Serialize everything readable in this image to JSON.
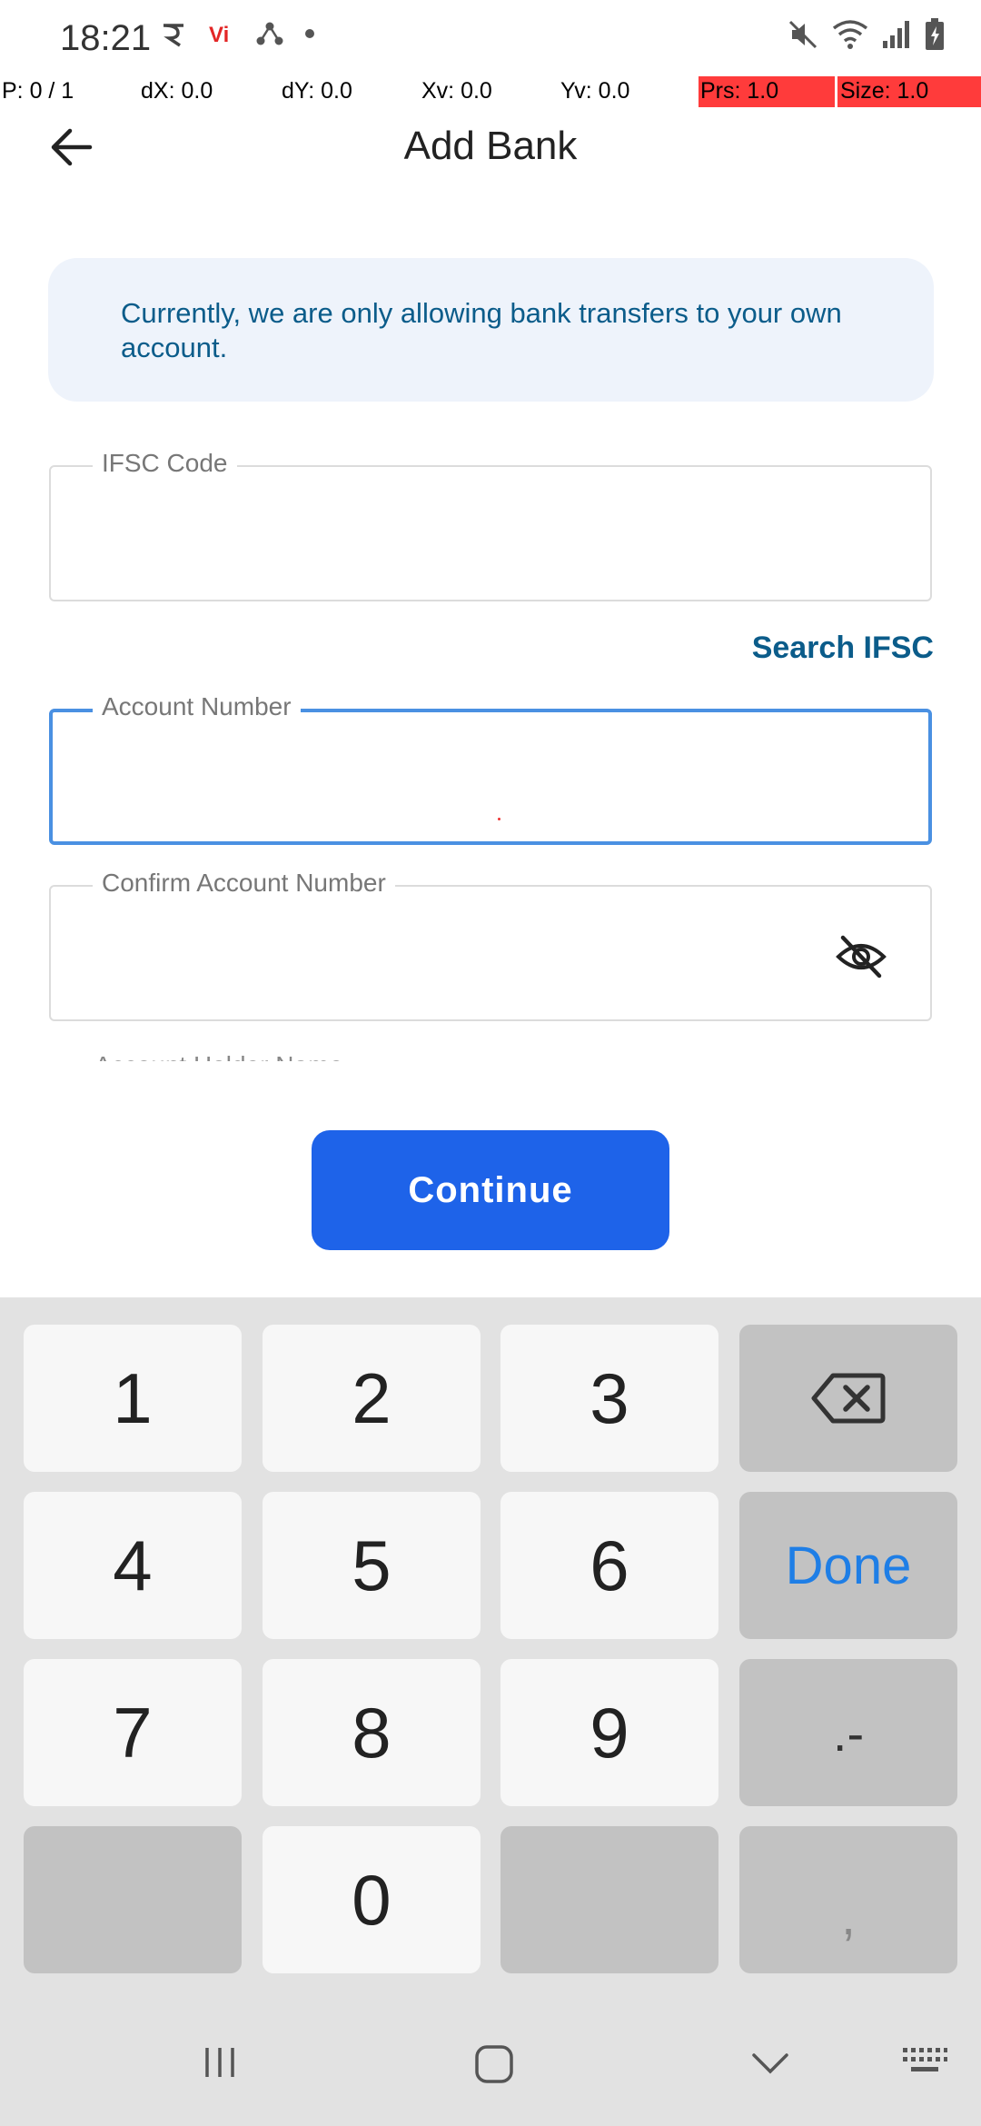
{
  "status_bar": {
    "time": "18:21",
    "left_icons": [
      "jio-icon",
      "vi-icon",
      "share-icon",
      "dot-icon"
    ],
    "right_icons": [
      "mute-icon",
      "wifi-icon",
      "signal-icon",
      "battery-icon"
    ]
  },
  "debug": {
    "p": "P: 0 / 1",
    "dx": "dX: 0.0",
    "dy": "dY: 0.0",
    "xv": "Xv: 0.0",
    "yv": "Yv: 0.0",
    "prs": "Prs: 1.0",
    "size": "Size: 1.0"
  },
  "app_bar": {
    "title": "Add Bank",
    "back_icon": "arrow-left-icon"
  },
  "info_banner": {
    "text": "Currently, we are only allowing bank transfers to your own account."
  },
  "form": {
    "ifsc": {
      "label": "IFSC Code",
      "value": ""
    },
    "search_ifsc": "Search IFSC",
    "account_number": {
      "label": "Account Number",
      "value": ""
    },
    "confirm_account_number": {
      "label": "Confirm Account Number",
      "value": "",
      "icon": "eye-off-icon"
    },
    "next_label_partial": "Account Holder Name"
  },
  "continue_label": "Continue",
  "keyboard": {
    "keys": [
      "1",
      "2",
      "3",
      "4",
      "5",
      "6",
      "7",
      "8",
      "9",
      "0"
    ],
    "done": "Done",
    "dot_dash": ".-",
    "comma": ",",
    "backspace_icon": "backspace-icon"
  },
  "nav_bar": {
    "items": [
      "recents-icon",
      "home-icon",
      "back-chevron-icon",
      "keyboard-icon"
    ]
  },
  "colors": {
    "accent": "#1e63e9",
    "info_text": "#0b5c8a",
    "info_bg": "#eef3fb",
    "focus_border": "#4a90e2",
    "done_text": "#1e7ee6",
    "debug_highlight": "#ff3b3b"
  }
}
